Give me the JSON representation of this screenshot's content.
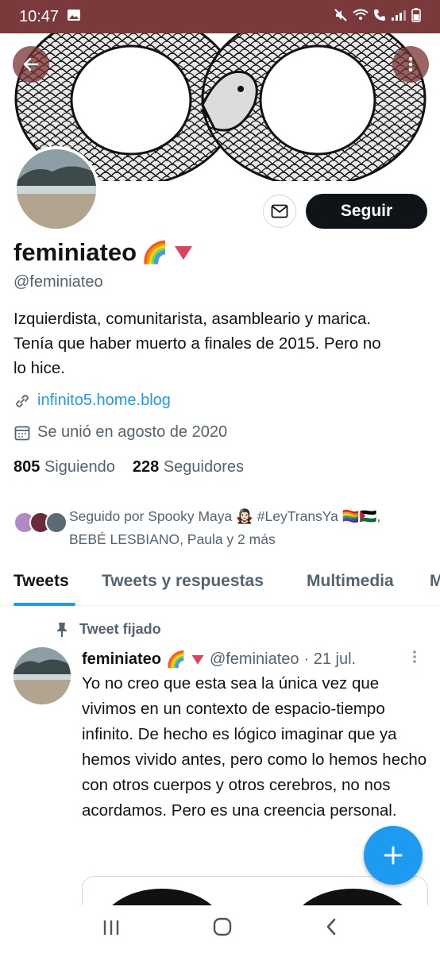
{
  "status_bar": {
    "time": "10:47"
  },
  "profile": {
    "display_name": "feminiateo",
    "name_emoji": "🌈",
    "handle": "@feminiateo",
    "bio": "Izquierdista, comunitarista, asambleario y marica. Tenía que haber muerto a finales de 2015. Pero no lo hice.",
    "website": "infinito5.home.blog",
    "joined": "Se unió en agosto de 2020",
    "following_count": "805",
    "following_label": "Siguiendo",
    "followers_count": "228",
    "followers_label": "Seguidores",
    "followed_by": "Seguido por Spooky Maya 🧛🏻‍♀️ #LeyTransYa 🏳️‍🌈🇵🇸, BEBÉ LESBIANO, Paula y 2 más"
  },
  "actions": {
    "follow_label": "Seguir"
  },
  "tabs": [
    {
      "label": "Tweets"
    },
    {
      "label": "Tweets y respuestas"
    },
    {
      "label": "Multimedia"
    },
    {
      "label": "M"
    }
  ],
  "pinned_tweet": {
    "pinned_label": "Tweet fijado",
    "author_name": "feminiateo",
    "author_emoji": "🌈",
    "author_handle": "@feminiateo",
    "date": "· 21 jul.",
    "text": "Yo no creo que esta sea la única vez que vivimos en un contexto de espacio-tiempo infinito. De hecho es lógico imaginar que ya hemos vivido antes, pero como lo hemos hecho con otros cuerpos y otros cerebros, no nos acordamos. Pero es una creencia personal."
  },
  "colors": {
    "accent": "#1d9bf0",
    "status_bar": "#7a3a3b",
    "text_primary": "#0f1419",
    "text_secondary": "#536471",
    "flag_triangle": "#e0405e"
  },
  "icons": [
    "back-arrow-icon",
    "more-vertical-icon",
    "mail-icon",
    "link-icon",
    "calendar-icon",
    "pin-icon",
    "plus-icon",
    "recents-icon",
    "home-icon",
    "back-icon"
  ]
}
